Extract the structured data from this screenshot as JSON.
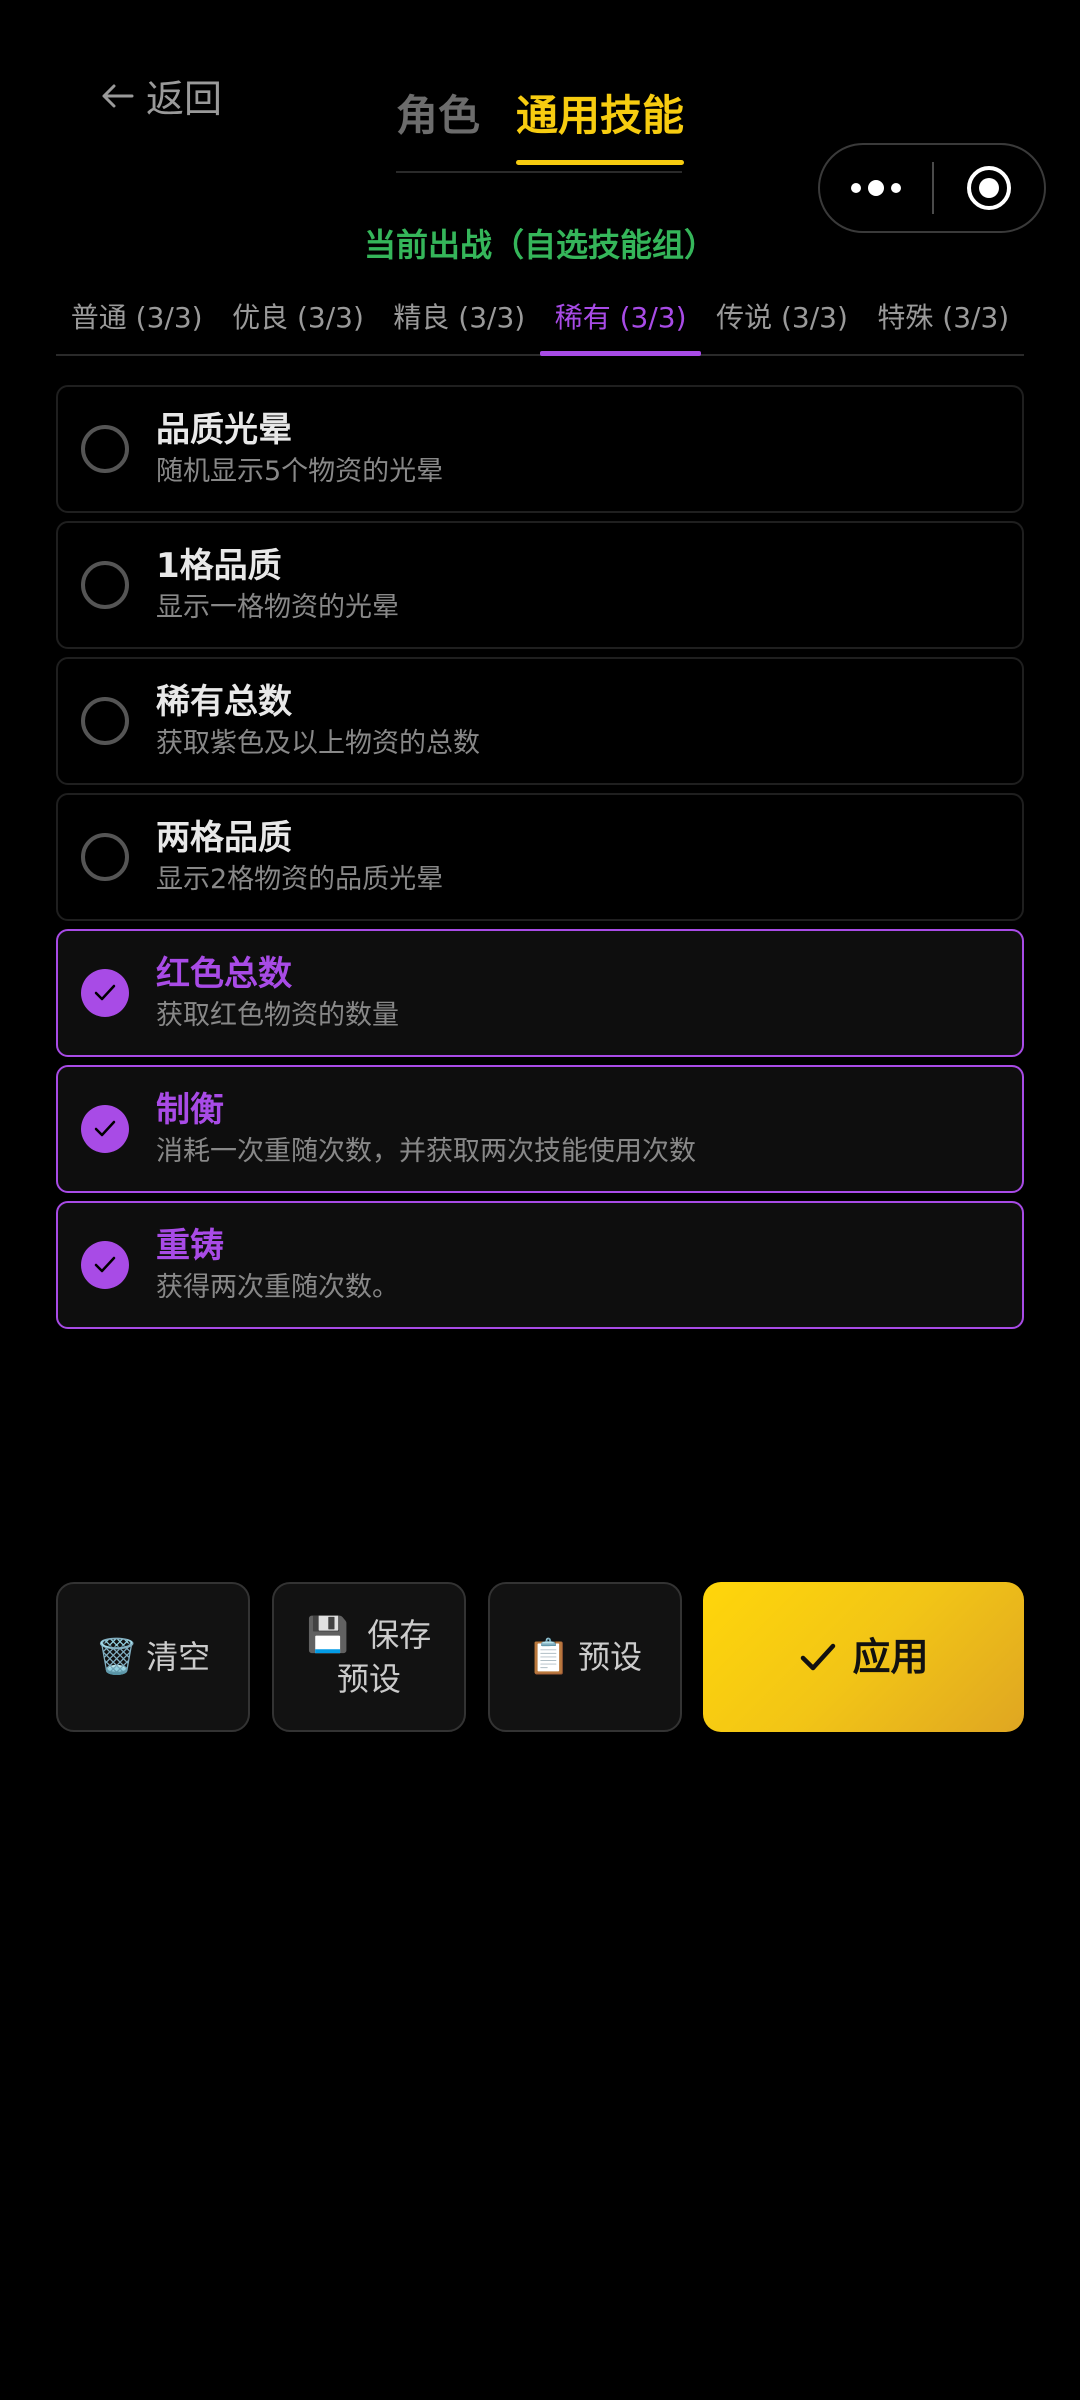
{
  "header": {
    "back_label": "返回",
    "tabs": [
      {
        "label": "角色",
        "active": false
      },
      {
        "label": "通用技能",
        "active": true
      }
    ]
  },
  "status": "当前出战（自选技能组）",
  "quality_tabs": [
    {
      "label": "普通 (3/3)",
      "active": false
    },
    {
      "label": "优良 (3/3)",
      "active": false
    },
    {
      "label": "精良 (3/3)",
      "active": false
    },
    {
      "label": "稀有 (3/3)",
      "active": true
    },
    {
      "label": "传说 (3/3)",
      "active": false
    },
    {
      "label": "特殊 (3/3)",
      "active": false
    }
  ],
  "skills": [
    {
      "name": "品质光晕",
      "desc": "随机显示5个物资的光晕",
      "selected": false
    },
    {
      "name": "1格品质",
      "desc": "显示一格物资的光晕",
      "selected": false
    },
    {
      "name": "稀有总数",
      "desc": "获取紫色及以上物资的总数",
      "selected": false
    },
    {
      "name": "两格品质",
      "desc": "显示2格物资的品质光晕",
      "selected": false
    },
    {
      "name": "红色总数",
      "desc": "获取红色物资的数量",
      "selected": true
    },
    {
      "name": "制衡",
      "desc": "消耗一次重随次数，并获取两次技能使用次数",
      "selected": true
    },
    {
      "name": "重铸",
      "desc": "获得两次重随次数。",
      "selected": true
    }
  ],
  "actions": {
    "clear": {
      "icon": "🗑️",
      "label": "清空"
    },
    "save_preset": {
      "icon": "💾",
      "label_line1": "保存",
      "label_line2": "预设"
    },
    "preset": {
      "icon": "📋",
      "label": "预设"
    },
    "apply": {
      "label": "应用"
    }
  },
  "colors": {
    "accent_yellow": "#f7cc10",
    "accent_purple": "#a84be6",
    "status_green": "#35b65a"
  }
}
